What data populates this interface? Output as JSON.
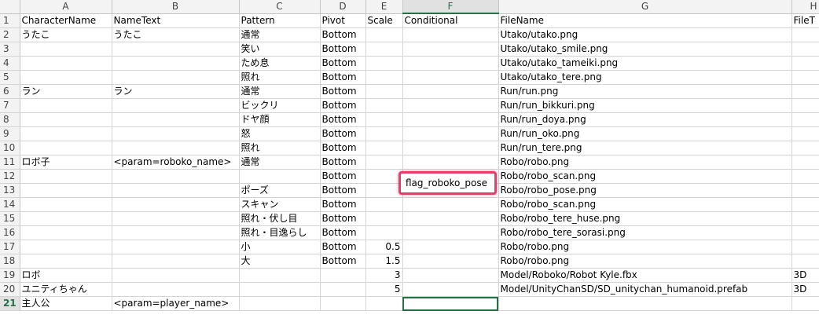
{
  "columns": [
    "A",
    "B",
    "C",
    "D",
    "E",
    "F",
    "G",
    "H"
  ],
  "active_column": "F",
  "rows": [
    {
      "n": "1",
      "A": "CharacterName",
      "B": "NameText",
      "C": "Pattern",
      "D": "Pivot",
      "E": "Scale",
      "F": "Conditional",
      "G": "FileName",
      "H": "FileT"
    },
    {
      "n": "2",
      "A": "うたこ",
      "B": "うたこ",
      "C": "通常",
      "D": "Bottom",
      "E": "",
      "F": "",
      "G": "Utako/utako.png",
      "H": ""
    },
    {
      "n": "3",
      "A": "",
      "B": "",
      "C": "笑い",
      "D": "Bottom",
      "E": "",
      "F": "",
      "G": "Utako/utako_smile.png",
      "H": ""
    },
    {
      "n": "4",
      "A": "",
      "B": "",
      "C": "ため息",
      "D": "Bottom",
      "E": "",
      "F": "",
      "G": "Utako/utako_tameiki.png",
      "H": ""
    },
    {
      "n": "5",
      "A": "",
      "B": "",
      "C": "照れ",
      "D": "Bottom",
      "E": "",
      "F": "",
      "G": "Utako/utako_tere.png",
      "H": ""
    },
    {
      "n": "6",
      "A": "ラン",
      "B": "ラン",
      "C": "通常",
      "D": "Bottom",
      "E": "",
      "F": "",
      "G": "Run/run.png",
      "H": ""
    },
    {
      "n": "7",
      "A": "",
      "B": "",
      "C": "ビックリ",
      "D": "Bottom",
      "E": "",
      "F": "",
      "G": "Run/run_bikkuri.png",
      "H": ""
    },
    {
      "n": "8",
      "A": "",
      "B": "",
      "C": "ドヤ顔",
      "D": "Bottom",
      "E": "",
      "F": "",
      "G": "Run/run_doya.png",
      "H": ""
    },
    {
      "n": "9",
      "A": "",
      "B": "",
      "C": "怒",
      "D": "Bottom",
      "E": "",
      "F": "",
      "G": "Run/run_oko.png",
      "H": ""
    },
    {
      "n": "10",
      "A": "",
      "B": "",
      "C": "照れ",
      "D": "Bottom",
      "E": "",
      "F": "",
      "G": "Run/run_tere.png",
      "H": ""
    },
    {
      "n": "11",
      "A": "ロボ子",
      "B": "<param=roboko_name>",
      "C": "通常",
      "D": "Bottom",
      "E": "",
      "F": "",
      "G": "Robo/robo.png",
      "H": ""
    },
    {
      "n": "12",
      "A": "",
      "B": "",
      "C": "",
      "D": "Bottom",
      "E": "",
      "F": "",
      "G": "Robo/robo_scan.png",
      "H": ""
    },
    {
      "n": "13",
      "A": "",
      "B": "",
      "C": "ポーズ",
      "D": "Bottom",
      "E": "",
      "F": "",
      "G": "Robo/robo_pose.png",
      "H": ""
    },
    {
      "n": "14",
      "A": "",
      "B": "",
      "C": "スキャン",
      "D": "Bottom",
      "E": "",
      "F": "",
      "G": "Robo/robo_scan.png",
      "H": ""
    },
    {
      "n": "15",
      "A": "",
      "B": "",
      "C": "照れ・伏し目",
      "D": "Bottom",
      "E": "",
      "F": "",
      "G": "Robo/robo_tere_huse.png",
      "H": ""
    },
    {
      "n": "16",
      "A": "",
      "B": "",
      "C": "照れ・目逸らし",
      "D": "Bottom",
      "E": "",
      "F": "",
      "G": "Robo/robo_tere_sorasi.png",
      "H": ""
    },
    {
      "n": "17",
      "A": "",
      "B": "",
      "C": "小",
      "D": "Bottom",
      "E": "0.5",
      "F": "",
      "G": "Robo/robo.png",
      "H": ""
    },
    {
      "n": "18",
      "A": "",
      "B": "",
      "C": "大",
      "D": "Bottom",
      "E": "1.5",
      "F": "",
      "G": "Robo/robo.png",
      "H": ""
    },
    {
      "n": "19",
      "A": "ロボ",
      "B": "",
      "C": "",
      "D": "",
      "E": "3",
      "F": "",
      "G": "Model/Roboko/Robot Kyle.fbx",
      "H": "3D"
    },
    {
      "n": "20",
      "A": "ユニティちゃん",
      "B": "",
      "C": "",
      "D": "",
      "E": "5",
      "F": "",
      "G": "Model/UnityChanSD/SD_unitychan_humanoid.prefab",
      "H": "3D"
    },
    {
      "n": "21",
      "A": "主人公",
      "B": "<param=player_name>",
      "C": "",
      "D": "",
      "E": "",
      "F": "",
      "G": "",
      "H": ""
    }
  ],
  "highlight": {
    "cell": "F12",
    "text": "flag_roboko_pose"
  },
  "selected_cell": "F21",
  "colors": {
    "highlight_border": "#ec3b6a",
    "selection": "#217346"
  }
}
